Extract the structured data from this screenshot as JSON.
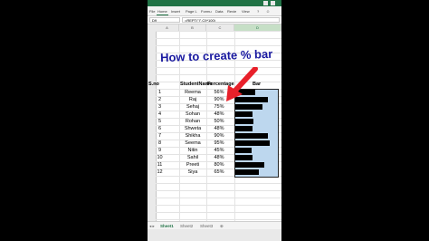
{
  "ribbon": {
    "tabs": [
      "File",
      "Home",
      "Insert",
      "Page L",
      "Formu",
      "Data",
      "Revie",
      "View"
    ]
  },
  "formula_bar": {
    "name_box": "D9",
    "formula": "=REPT(\"|\",C9*100)"
  },
  "columns": [
    "A",
    "B",
    "C",
    "D"
  ],
  "overlay_title": "How to create % bar",
  "table": {
    "headers": [
      "S.no",
      "StudentName",
      "Percentage",
      "Bar"
    ],
    "rows": [
      {
        "sno": "1",
        "name": "Reema",
        "pct": "56%",
        "value": 0.56
      },
      {
        "sno": "2",
        "name": "Raj",
        "pct": "90%",
        "value": 0.9
      },
      {
        "sno": "3",
        "name": "Sehaj",
        "pct": "75%",
        "value": 0.75
      },
      {
        "sno": "4",
        "name": "Sohan",
        "pct": "48%",
        "value": 0.48
      },
      {
        "sno": "5",
        "name": "Rohan",
        "pct": "50%",
        "value": 0.5
      },
      {
        "sno": "6",
        "name": "Shweta",
        "pct": "48%",
        "value": 0.48
      },
      {
        "sno": "7",
        "name": "Shikha",
        "pct": "90%",
        "value": 0.9
      },
      {
        "sno": "8",
        "name": "Seema",
        "pct": "95%",
        "value": 0.95
      },
      {
        "sno": "9",
        "name": "Nitin",
        "pct": "45%",
        "value": 0.45
      },
      {
        "sno": "10",
        "name": "Sahil",
        "pct": "48%",
        "value": 0.48
      },
      {
        "sno": "11",
        "name": "Preeti",
        "pct": "80%",
        "value": 0.8
      },
      {
        "sno": "12",
        "name": "Siya",
        "pct": "65%",
        "value": 0.65
      }
    ]
  },
  "sheets": [
    "Sheet1",
    "Sheet2",
    "Sheet3"
  ],
  "colors": {
    "excel_green": "#217346",
    "bar_fill": "#000000",
    "bar_column": "#bdd7ee",
    "title": "#1a1aa0",
    "arrow": "#e8202a"
  }
}
